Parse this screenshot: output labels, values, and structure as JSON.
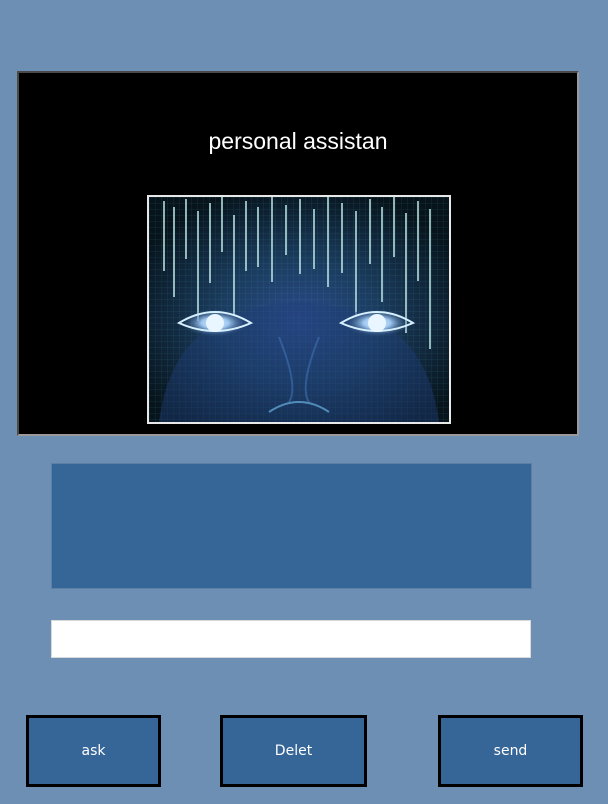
{
  "header": {
    "title": "personal assistan"
  },
  "avatar": {
    "icon": "ai-face-icon"
  },
  "output": {
    "text": ""
  },
  "input": {
    "value": "",
    "placeholder": ""
  },
  "buttons": {
    "ask": "ask",
    "delet": "Delet",
    "send": "send"
  },
  "colors": {
    "background": "#6d8fb3",
    "panel": "#366597",
    "header": "#000000"
  }
}
